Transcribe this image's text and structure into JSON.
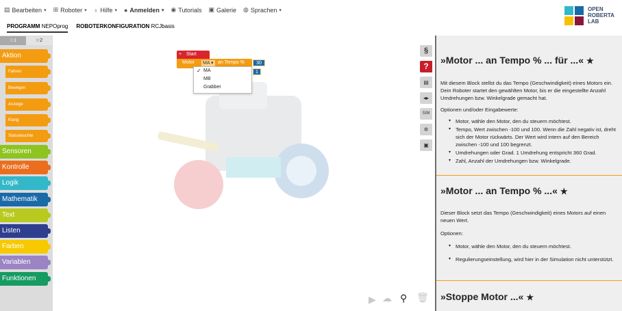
{
  "menu": [
    {
      "icon": "clipboard-icon",
      "label": "Bearbeiten",
      "caret": "▾",
      "bold": false
    },
    {
      "icon": "robot-icon",
      "label": "Roboter",
      "caret": "▾",
      "bold": false
    },
    {
      "icon": "lightbulb-icon",
      "label": "Hilfe",
      "caret": "▾",
      "bold": false
    },
    {
      "icon": "user-icon",
      "label": "Anmelden",
      "caret": "▾",
      "bold": true
    },
    {
      "icon": "eye-icon",
      "label": "Tutorials",
      "caret": "",
      "bold": false
    },
    {
      "icon": "gallery-icon",
      "label": "Galerie",
      "caret": "",
      "bold": false
    },
    {
      "icon": "globe-icon",
      "label": "Sprachen",
      "caret": "▾",
      "bold": false
    }
  ],
  "subtabs": [
    {
      "label": "PROGRAMM",
      "name": "NEPOprog",
      "active": true
    },
    {
      "label": "ROBOTERKONFIGURATION",
      "name": "RCJbasis",
      "active": false
    }
  ],
  "logo": {
    "line1": "OPEN",
    "line2": "ROBERTA",
    "line3": "LAB",
    "colors": [
      "#33b8ca",
      "#1a6aa8",
      "#f9c000",
      "#8a1538"
    ]
  },
  "level_tabs": [
    {
      "label": "☆1",
      "active": true
    },
    {
      "label": "☆2",
      "active": false
    }
  ],
  "categories": [
    {
      "label": "Aktion",
      "color": "#f39c12"
    },
    {
      "label": "Sensoren",
      "color": "#8fc31f"
    },
    {
      "label": "Kontrolle",
      "color": "#eb6e1e"
    },
    {
      "label": "Logik",
      "color": "#33b8ca"
    },
    {
      "label": "Mathematik",
      "color": "#1a6aa8"
    },
    {
      "label": "Text",
      "color": "#b8ca1f"
    },
    {
      "label": "Listen",
      "color": "#2e3f8f"
    },
    {
      "label": "Farben",
      "color": "#f7c900"
    },
    {
      "label": "Variablen",
      "color": "#9a84c4"
    },
    {
      "label": "Funktionen",
      "color": "#169b62"
    }
  ],
  "subcategories": [
    "Fahren",
    "Bewegen",
    "Anzeige",
    "Klang",
    "Statusleuchte"
  ],
  "blocks": {
    "start_label": "Start",
    "motor_label": "Motor",
    "motor_value": "MA ▾",
    "tempo_label": "an Tempo %",
    "tempo_value": "30",
    "count_value": "1"
  },
  "dropdown": {
    "check": "✓",
    "options": [
      "MA",
      "MB",
      "Grabber"
    ]
  },
  "right_tools": [
    {
      "label": "§",
      "icon": "code-icon"
    },
    {
      "label": "?",
      "icon": "help-icon"
    },
    {
      "label": "▤",
      "icon": "comment-icon"
    },
    {
      "label": "◂▸",
      "icon": "source-icon"
    },
    {
      "label": "SIM",
      "icon": "sim-icon"
    },
    {
      "label": "✲",
      "icon": "settings-icon"
    },
    {
      "label": "▣",
      "icon": "screen-icon"
    }
  ],
  "help": {
    "sections": [
      {
        "title": "»Motor ... an Tempo % ... für ...«",
        "star": "★",
        "intro": "Mit diesem Block stellst du das Tempo (Geschwindigkeit) eines Motors ein. Dein Roboter startet den gewählten Motor, bis er die eingestellte Anzahl Umdrehungen bzw. Winkelgrade gemacht hat.",
        "options_label": "Optionen und/oder Eingabewerte:",
        "items": [
          "Motor, wähle den Motor, den du steuern möchtest.",
          "Tempo, Wert zwischen -100 und 100. Wenn die Zahl negativ ist, dreht sich der Motor rückwärts. Der Wert wird intern auf den Bereich zwischen -100 und 100 begrenzt.",
          "Umdrehungen oder Grad. 1 Umdrehung entspricht 360 Grad.",
          "Zahl, Anzahl der Umdrehungen bzw. Winkelgrade."
        ]
      },
      {
        "title": "»Motor ... an Tempo % ...«",
        "star": "★",
        "intro": "Dieser Block setzt das Tempo (Geschwindigkeit) eines Motors auf einen neuen Wert.",
        "options_label": "Optionen:",
        "items": [
          "Motor, wähle den Motor, den du steuern möchtest.",
          "Regulierungseinstellung, wird hier in der Simulation nicht unterstützt."
        ]
      },
      {
        "title": "»Stoppe Motor ...«",
        "star": "★"
      }
    ]
  },
  "bottom_tools": [
    {
      "icon": "play-icon",
      "glyph": "▶"
    },
    {
      "icon": "cloud-upload-icon",
      "glyph": "☁"
    },
    {
      "icon": "zoom-icon",
      "glyph": "⚲"
    },
    {
      "icon": "trash-icon",
      "glyph": "🗑"
    }
  ]
}
